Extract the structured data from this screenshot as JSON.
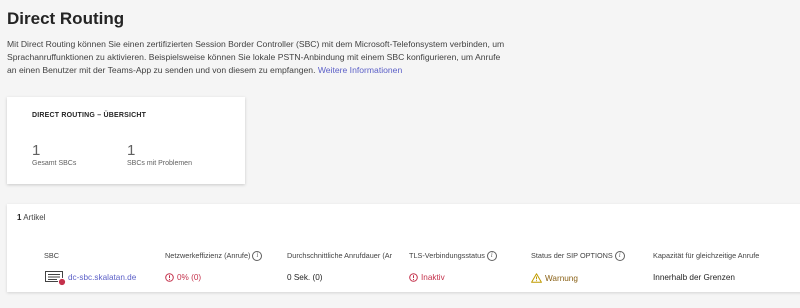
{
  "header": {
    "title": "Direct Routing",
    "description": "Mit Direct Routing können Sie einen zertifizierten Session Border Controller (SBC) mit dem Microsoft-Telefonsystem verbinden, um Sprachanruffunktionen zu aktivieren. Beispielsweise können Sie lokale PSTN-Anbindung mit einem SBC konfigurieren, um Anrufe an einen Benutzer mit der Teams-App zu senden und von diesem zu empfangen.",
    "more_link": "Weitere Informationen"
  },
  "overview": {
    "title": "DIRECT ROUTING – ÜBERSICHT",
    "stats": [
      {
        "value": "1",
        "label": "Gesamt SBCs"
      },
      {
        "value": "1",
        "label": "SBCs mit Problemen"
      }
    ]
  },
  "table": {
    "count_number": "1",
    "count_label": "Artikel",
    "columns": [
      "SBC",
      "Netzwerkeffizienz (Anrufe)",
      "Durchschnittliche Anrufdauer (Ar",
      "TLS-Verbindungsstatus",
      "Status der SIP OPTIONS",
      "Kapazität für gleichzeitige Anrufe"
    ],
    "rows": [
      {
        "sbc": "dc-sbc.skalatan.de",
        "network_efficiency": "0% (0)",
        "avg_duration": "0 Sek. (0)",
        "tls_status": "Inaktiv",
        "sip_options": "Warnung",
        "capacity": "Innerhalb der Grenzen"
      }
    ]
  },
  "colors": {
    "accent": "#5b5fc7",
    "error": "#c4314b",
    "warning": "#c19c00"
  },
  "icons": [
    "info-icon",
    "sbc-device-icon",
    "error-badge-icon",
    "error-circle-icon",
    "warning-triangle-icon"
  ]
}
